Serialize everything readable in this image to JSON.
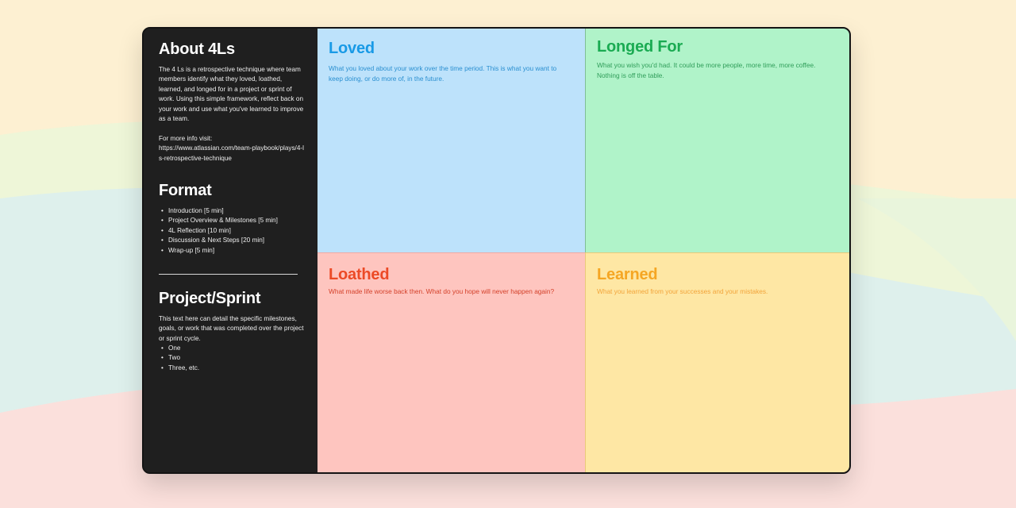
{
  "about": {
    "title": "About 4Ls",
    "description": "The 4 Ls is a retrospective technique where team members identify what they loved, loathed, learned, and longed for in a project or sprint of work. Using this simple framework, reflect back on your work and use what you've learned to improve as a team.",
    "more_info_label": "For more info visit:",
    "more_info_url": "https://www.atlassian.com/team-playbook/plays/4-ls-retrospective-technique"
  },
  "format": {
    "title": "Format",
    "items": [
      "Introduction [5 min]",
      "Project Overview & Milestones [5 min]",
      "4L Reflection [10 min]",
      "Discussion & Next Steps [20 min]",
      "Wrap-up [5 min]"
    ]
  },
  "project": {
    "title": "Project/Sprint",
    "description": "This text here can detail the specific milestones, goals, or work that was completed over the project or sprint cycle.",
    "items": [
      "One",
      "Two",
      "Three, etc."
    ]
  },
  "quadrants": {
    "loved": {
      "title": "Loved",
      "text": "What you loved about your work over the time period. This is what you want to keep doing, or do more of, in the future."
    },
    "longed": {
      "title": "Longed For",
      "text": "What you wish you'd had. It could be more people, more time, more coffee. Nothing is off the table."
    },
    "loathed": {
      "title": "Loathed",
      "text": "What made life worse back then. What do you hope will never happen again?"
    },
    "learned": {
      "title": "Learned",
      "text": "What you learned from your successes and your mistakes."
    }
  },
  "colors": {
    "loved_bg": "#bde2fb",
    "loved_accent": "#199ae6",
    "longed_bg": "#b0f3c9",
    "longed_accent": "#1aab52",
    "loathed_bg": "#fec5bf",
    "loathed_accent": "#ec4a26",
    "learned_bg": "#fee7a4",
    "learned_accent": "#f5a623",
    "sidebar_bg": "#1f1f1f"
  }
}
